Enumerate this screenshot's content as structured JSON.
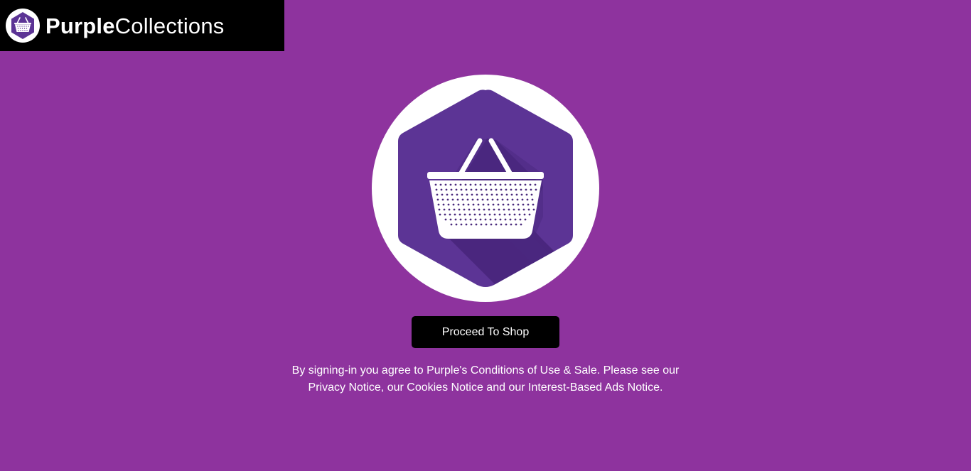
{
  "brand": {
    "name_bold": "Purple",
    "name_light": "Collections",
    "logo_icon": "shopping-basket-icon"
  },
  "hero": {
    "icon": "shopping-basket-hexagon-icon"
  },
  "cta": {
    "label": "Proceed To Shop"
  },
  "legal": {
    "line1": "By signing-in you agree to Purple's Conditions of Use & Sale. Please see our",
    "line2": "Privacy Notice, our Cookies Notice and our Interest-Based Ads Notice."
  },
  "colors": {
    "background": "#8e339e",
    "header_bar": "#000000",
    "hexagon": "#5c3495",
    "button": "#000000",
    "text": "#ffffff"
  }
}
